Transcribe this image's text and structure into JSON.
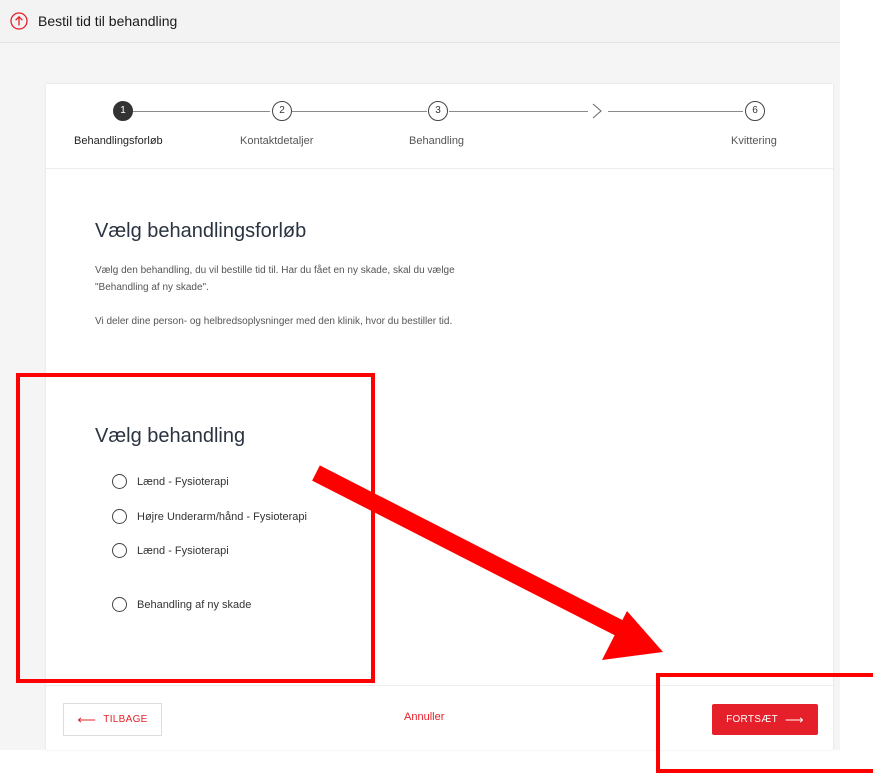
{
  "header": {
    "title": "Bestil tid til behandling",
    "icon": "arrow-up-circle-icon",
    "accent_color": "#e5202a"
  },
  "stepper": {
    "steps": [
      {
        "number": "1",
        "label": "Behandlingsforløb",
        "active": true
      },
      {
        "number": "2",
        "label": "Kontaktdetaljer",
        "active": false
      },
      {
        "number": "3",
        "label": "Behandling",
        "active": false
      },
      {
        "number": "6",
        "label": "Kvittering",
        "active": false
      }
    ],
    "collapsed_indicator_icon": "chevron-right-icon"
  },
  "intro": {
    "heading": "Vælg behandlingsforløb",
    "paragraph_1_line_1": "Vælg den behandling, du vil bestille tid til. Har du fået en ny skade, skal du vælge",
    "paragraph_1_line_2": "\"Behandling af ny skade\".",
    "paragraph_2": "Vi deler dine person- og helbredsoplysninger med den klinik, hvor du bestiller tid."
  },
  "treatment": {
    "heading": "Vælg behandling",
    "options": [
      {
        "label": "Lænd - Fysioterapi",
        "selected": false
      },
      {
        "label": "Højre Underarm/hånd - Fysioterapi",
        "selected": false
      },
      {
        "label": "Lænd - Fysioterapi",
        "selected": false
      },
      {
        "label": "Behandling af ny skade",
        "selected": false
      }
    ]
  },
  "footer": {
    "back_label": "TILBAGE",
    "cancel_label": "Annuller",
    "next_label": "FORTSÆT"
  },
  "annotation": {
    "color": "#ff0000"
  }
}
